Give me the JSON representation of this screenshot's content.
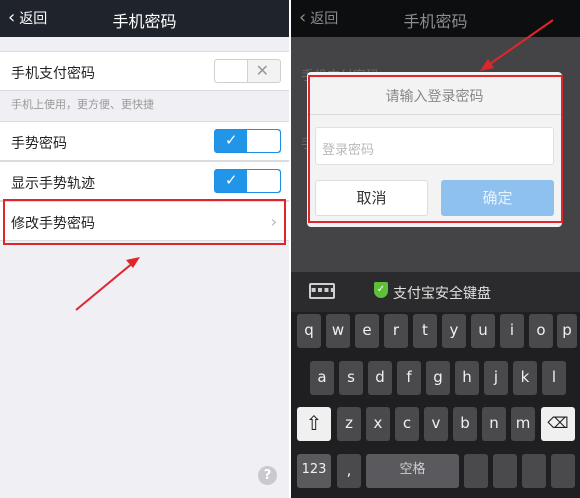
{
  "left": {
    "nav": {
      "back_label": "返回",
      "title": "手机密码"
    },
    "rows": {
      "pay_password": "手机支付密码",
      "pay_hint": "手机上使用，更方便、更快捷",
      "gesture_password": "手势密码",
      "show_trace": "显示手势轨迹",
      "modify_gesture": "修改手势密码"
    }
  },
  "right": {
    "nav": {
      "back_label": "返回",
      "title": "手机密码"
    },
    "dim_rows": [
      "手机支付密码",
      "手"
    ],
    "dialog": {
      "title": "请输入登录密码",
      "input_placeholder": "登录密码",
      "cancel_label": "取消",
      "confirm_label": "确定"
    },
    "keyboard": {
      "title": "支付宝安全键盘",
      "row1": [
        "q",
        "w",
        "e",
        "r",
        "t",
        "y",
        "u",
        "i",
        "o",
        "p"
      ],
      "row2": [
        "a",
        "s",
        "d",
        "f",
        "g",
        "h",
        "j",
        "k",
        "l"
      ],
      "row3": [
        "z",
        "x",
        "c",
        "v",
        "b",
        "n",
        "m"
      ],
      "num_label": "123",
      "comma": ",",
      "space_label": "空格"
    }
  },
  "colors": {
    "accent": "#2196e8",
    "annotation_red": "#e0262c",
    "nav_bg": "#1f232b"
  }
}
